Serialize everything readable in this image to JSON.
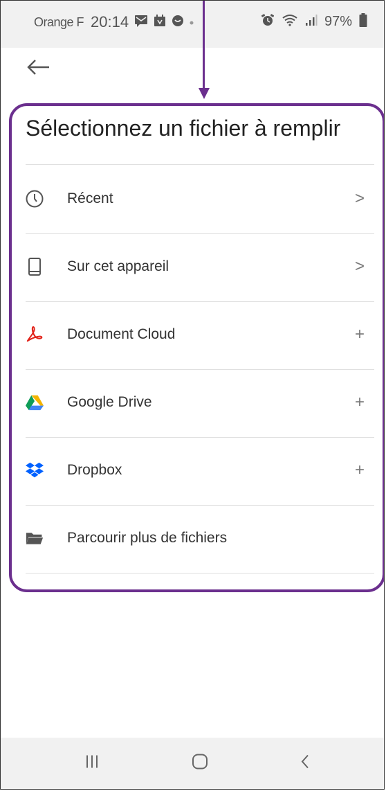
{
  "status_bar": {
    "carrier": "Orange F",
    "time": "20:14",
    "battery": "97%"
  },
  "header": {
    "back_icon": "arrow-left-icon"
  },
  "title": "Sélectionnez un fichier à remplir",
  "items": [
    {
      "label": "Récent",
      "icon": "clock-icon",
      "trailing": ">"
    },
    {
      "label": "Sur cet appareil",
      "icon": "phone-device-icon",
      "trailing": ">"
    },
    {
      "label": "Document Cloud",
      "icon": "acrobat-icon",
      "trailing": "+"
    },
    {
      "label": "Google Drive",
      "icon": "google-drive-icon",
      "trailing": "+"
    },
    {
      "label": "Dropbox",
      "icon": "dropbox-icon",
      "trailing": "+"
    },
    {
      "label": "Parcourir plus de fichiers",
      "icon": "folder-icon",
      "trailing": ""
    }
  ],
  "annotation": {
    "color": "#6b2f8e"
  },
  "colors": {
    "acrobat_red": "#e2231a",
    "dropbox_blue": "#0061ff",
    "drive_green": "#0f9d58",
    "drive_yellow": "#f4b400",
    "drive_blue": "#4285f4"
  },
  "nav_bar": {
    "buttons": [
      "recent-apps-icon",
      "home-icon",
      "back-nav-icon"
    ]
  }
}
